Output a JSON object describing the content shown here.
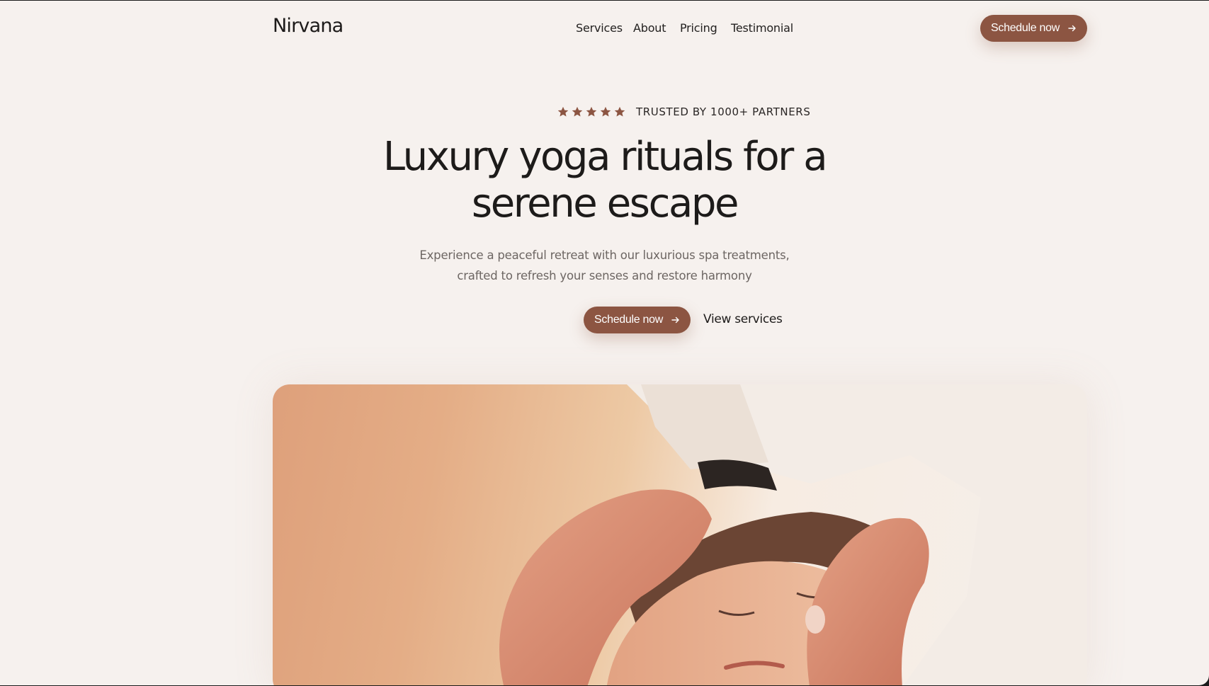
{
  "header": {
    "logo": "Nirvana",
    "nav": [
      "Services",
      "About",
      "Pricing",
      "Testimonial"
    ],
    "cta_label": "Schedule now"
  },
  "hero": {
    "rating_stars": 5,
    "trust_text": "TRUSTED BY 1000+ PARTNERS",
    "title_line1": "Luxury yoga rituals for a",
    "title_line2": "serene escape",
    "subtitle_line1": "Experience a peaceful retreat with our luxurious spa treatments,",
    "subtitle_line2": "crafted to refresh your senses and restore harmony",
    "primary_cta": "Schedule now",
    "secondary_cta": "View services",
    "image": "spa-massage-photo"
  },
  "colors": {
    "background": "#f6f1ee",
    "accent": "#8c5542",
    "text": "#1d1b1a",
    "muted": "#6d6663"
  },
  "icons": [
    "star-icon",
    "arrow-right-icon"
  ]
}
